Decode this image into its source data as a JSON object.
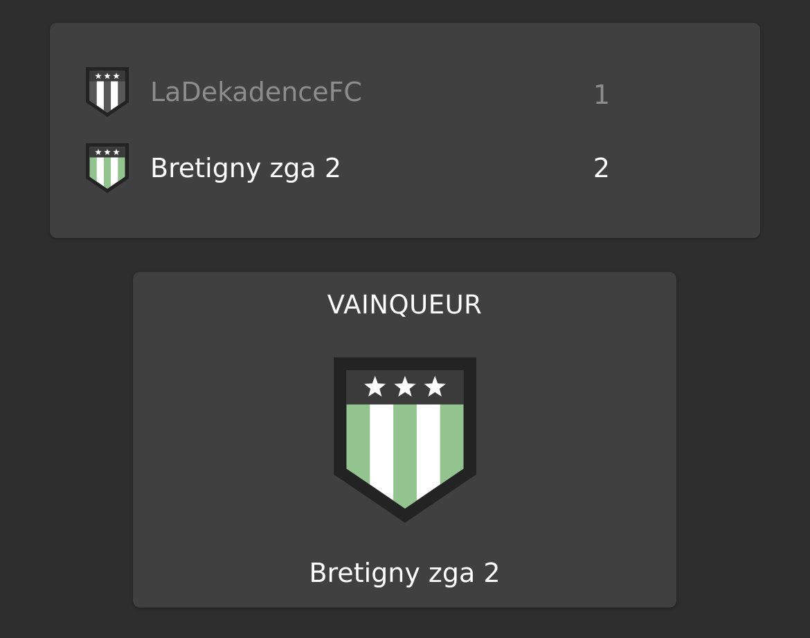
{
  "match": {
    "teams": [
      {
        "name": "LaDekadenceFC",
        "score": "1",
        "result": "loser",
        "crest": {
          "icon": "shield-crest-icon",
          "stripe_color": "#575757",
          "band_color": "#3b3b3b",
          "border_color": "#232323",
          "star_color": "#ffffff"
        }
      },
      {
        "name": "Bretigny zga 2",
        "score": "2",
        "result": "winner",
        "crest": {
          "icon": "shield-crest-icon",
          "stripe_color": "#93c48f",
          "band_color": "#3b3b3b",
          "border_color": "#232323",
          "star_color": "#ffffff"
        }
      }
    ]
  },
  "winner": {
    "title": "VAINQUEUR",
    "name": "Bretigny zga 2",
    "crest": {
      "icon": "shield-crest-icon",
      "stripe_color": "#93c48f",
      "band_color": "#3b3b3b",
      "border_color": "#232323",
      "star_color": "#ffffff"
    }
  },
  "colors": {
    "background": "#2d2d2d",
    "card": "#404040",
    "text_primary": "#ffffff",
    "text_muted": "#8d8d8d"
  }
}
